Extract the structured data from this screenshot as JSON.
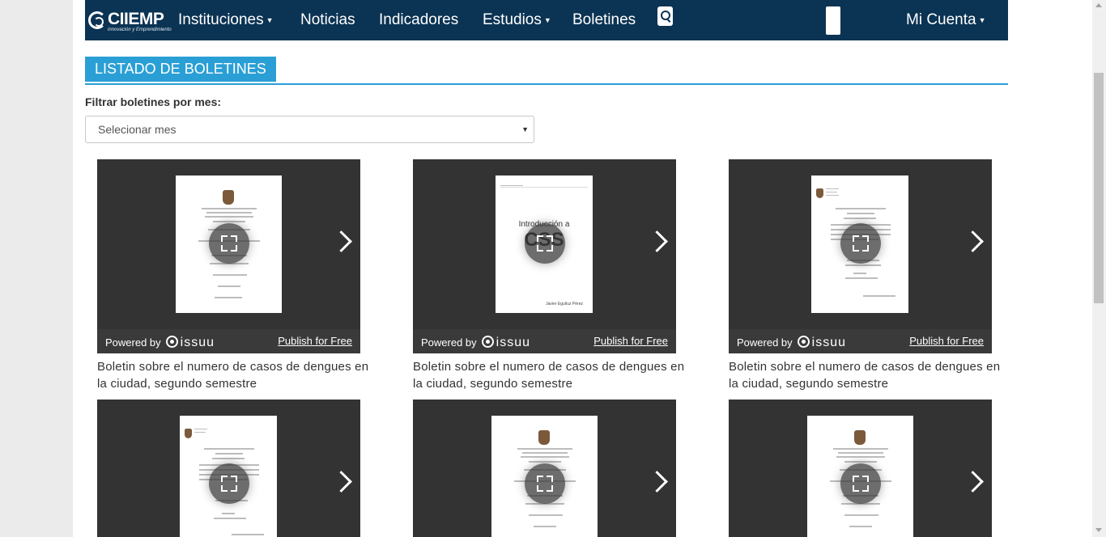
{
  "navbar": {
    "brand_name": "CIIEMP",
    "brand_tagline": "innovación y Emprendimiento",
    "items": [
      {
        "label": "Instituciones",
        "dropdown": true
      },
      {
        "label": "Noticias",
        "dropdown": false
      },
      {
        "label": "Indicadores",
        "dropdown": false
      },
      {
        "label": "Estudios",
        "dropdown": true
      },
      {
        "label": "Boletines",
        "dropdown": false
      }
    ],
    "account_label": "Mi Cuenta",
    "search_icon": "search-icon",
    "bg_color": "#0b3353"
  },
  "section": {
    "title": "LISTADO DE BOLETINES",
    "accent_color": "#2a9fd6"
  },
  "filter": {
    "label": "Filtrar boletines por mes:",
    "selected": "Selecionar mes"
  },
  "viewer": {
    "powered_by": "Powered by",
    "brand": "issuu",
    "publish_link": "Publish for Free"
  },
  "bulletins": [
    {
      "title": "Boletin sobre el numero de casos de dengues en la ciudad, segundo semestre",
      "cover": "university"
    },
    {
      "title": "Boletin sobre el numero de casos de dengues en la ciudad, segundo semestre",
      "cover": "css",
      "cover_heading": "Introducción a",
      "cover_big": "CSS",
      "cover_author": "Javier Eguíluz Pérez"
    },
    {
      "title": "Boletin sobre el numero de casos de dengues en la ciudad, segundo semestre",
      "cover": "letter"
    },
    {
      "title": "",
      "cover": "letter"
    },
    {
      "title": "",
      "cover": "university"
    },
    {
      "title": "",
      "cover": "university"
    }
  ]
}
